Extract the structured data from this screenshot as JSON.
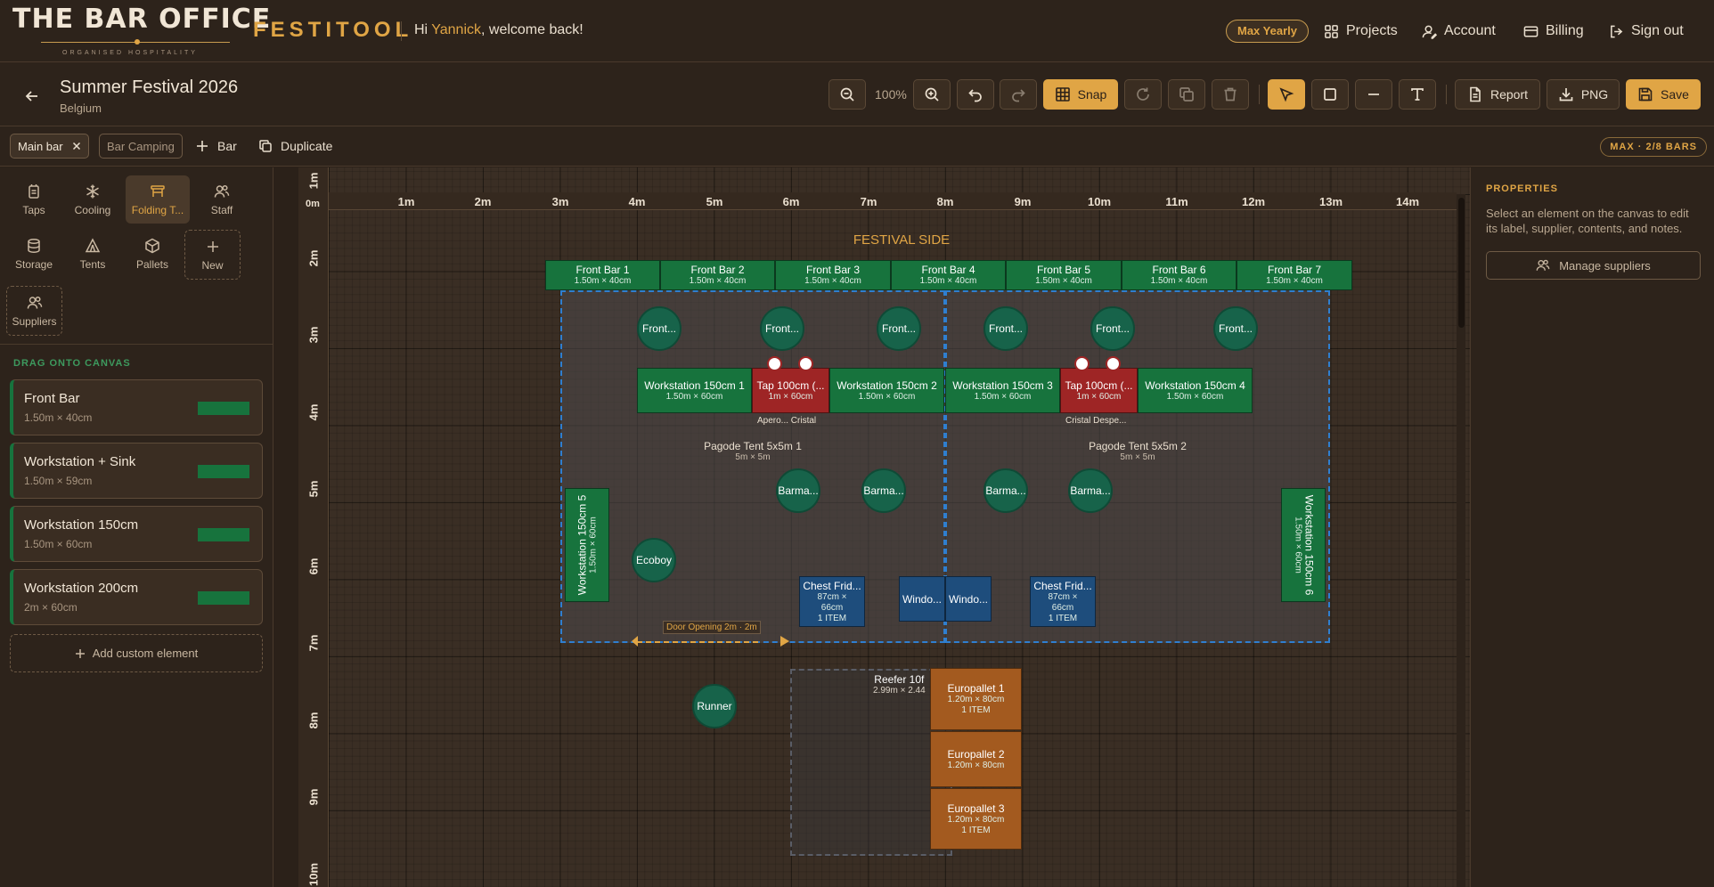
{
  "app": {
    "logo_line1": "THE BAR OFFICE",
    "logo_line2": "ORGANISED HOSPITALITY",
    "product": "FESTITOOL",
    "greeting_prefix": "Hi ",
    "user_name": "Yannick",
    "greeting_suffix": ", welcome back!",
    "plan_badge": "Max Yearly",
    "nav": {
      "projects": "Projects",
      "account": "Account",
      "billing": "Billing",
      "sign_out": "Sign out"
    },
    "accent_color": "#e0a545"
  },
  "project": {
    "title": "Summer Festival 2026",
    "country": "Belgium"
  },
  "toolbar": {
    "zoom": "100%",
    "snap_label": "Snap",
    "report_label": "Report",
    "png_label": "PNG",
    "save_label": "Save",
    "active_tool": "select",
    "snap_enabled": true
  },
  "bars": {
    "tabs": [
      {
        "label": "Main bar",
        "selected": true
      },
      {
        "label": "Bar Camping",
        "selected": false
      }
    ],
    "add_label": "Bar",
    "duplicate_label": "Duplicate",
    "max_badge": "MAX · 2/8 BARS"
  },
  "categories": [
    {
      "label": "Taps",
      "icon": "tap-icon"
    },
    {
      "label": "Cooling",
      "icon": "snowflake-icon"
    },
    {
      "label": "Folding T...",
      "icon": "folding-table-icon",
      "selected": true
    },
    {
      "label": "Staff",
      "icon": "staff-icon"
    },
    {
      "label": "Storage",
      "icon": "storage-icon"
    },
    {
      "label": "Tents",
      "icon": "tent-icon"
    },
    {
      "label": "Pallets",
      "icon": "pallet-icon"
    },
    {
      "label": "New",
      "icon": "plus-icon"
    },
    {
      "label": "Suppliers",
      "icon": "suppliers-icon"
    }
  ],
  "palette": {
    "title": "DRAG ONTO CANVAS",
    "items": [
      {
        "name": "Front Bar",
        "dims": "1.50m × 40cm"
      },
      {
        "name": "Workstation + Sink",
        "dims": "1.50m × 59cm"
      },
      {
        "name": "Workstation 150cm",
        "dims": "1.50m × 60cm"
      },
      {
        "name": "Workstation 200cm",
        "dims": "2m × 60cm"
      }
    ],
    "add_custom": "Add custom element",
    "swatch_color": "#17733d"
  },
  "properties": {
    "title": "PROPERTIES",
    "help": "Select an element on the canvas to edit its label, supplier, contents, and notes.",
    "manage_suppliers": "Manage suppliers"
  },
  "canvas": {
    "ruler_x": [
      "1m",
      "2m",
      "3m",
      "4m",
      "5m",
      "6m",
      "7m",
      "8m",
      "9m",
      "10m",
      "11m",
      "12m",
      "13m",
      "14m"
    ],
    "ruler_y": [
      "1m",
      "2m",
      "3m",
      "4m",
      "5m",
      "6m",
      "7m",
      "8m",
      "9m",
      "10m"
    ],
    "origin": "0m",
    "festival_side": "FESTIVAL SIDE",
    "front_bars": [
      {
        "name": "Front Bar 1",
        "dims": "1.50m × 40cm"
      },
      {
        "name": "Front Bar 2",
        "dims": "1.50m × 40cm"
      },
      {
        "name": "Front Bar 3",
        "dims": "1.50m × 40cm"
      },
      {
        "name": "Front Bar 4",
        "dims": "1.50m × 40cm"
      },
      {
        "name": "Front Bar 5",
        "dims": "1.50m × 40cm"
      },
      {
        "name": "Front Bar 6",
        "dims": "1.50m × 40cm"
      },
      {
        "name": "Front Bar 7",
        "dims": "1.50m × 40cm"
      }
    ],
    "tents": [
      {
        "name": "Pagode Tent 5x5m 1",
        "dims": "5m × 5m"
      },
      {
        "name": "Pagode Tent 5x5m 2",
        "dims": "5m × 5m"
      }
    ],
    "front_staff": [
      "Front...",
      "Front...",
      "Front...",
      "Front...",
      "Front...",
      "Front..."
    ],
    "workstations": [
      {
        "name": "Workstation 150cm 1",
        "dims": "1.50m × 60cm"
      },
      {
        "name": "Workstation 150cm 2",
        "dims": "1.50m × 60cm"
      },
      {
        "name": "Workstation 150cm 3",
        "dims": "1.50m × 60cm"
      },
      {
        "name": "Workstation 150cm 4",
        "dims": "1.50m × 60cm"
      },
      {
        "name": "Workstation 150cm 5",
        "dims": "1.50m × 60cm"
      },
      {
        "name": "Workstation 150cm 6",
        "dims": "1.50m × 60cm"
      }
    ],
    "taps": [
      {
        "name": "Tap 100cm (...",
        "dims": "1m × 60cm",
        "labels": "Apero...   Cristal"
      },
      {
        "name": "Tap 100cm (...",
        "dims": "1m × 60cm",
        "labels": "Cristal   Despe..."
      }
    ],
    "barmen": [
      "Barma...",
      "Barma...",
      "Barma...",
      "Barma..."
    ],
    "ecoboy": "Ecoboy",
    "runner": "Runner",
    "chest_fridges": [
      {
        "name": "Chest Frid...",
        "dims": "87cm ×",
        "dims2": "66cm",
        "items": "1 ITEM"
      },
      {
        "name": "Chest Frid...",
        "dims": "87cm ×",
        "dims2": "66cm",
        "items": "1 ITEM"
      }
    ],
    "windows": [
      "Windo...",
      "Windo..."
    ],
    "door": "Door Opening 2m · 2m",
    "reefer": {
      "name": "Reefer 10f",
      "dims": "2.99m × 2.44"
    },
    "pallets": [
      {
        "name": "Europallet 1",
        "dims": "1.20m × 80cm",
        "items": "1 ITEM"
      },
      {
        "name": "Europallet 2",
        "dims": "1.20m × 80cm",
        "items": ""
      },
      {
        "name": "Europallet 3",
        "dims": "1.20m × 80cm",
        "items": "1 ITEM"
      }
    ]
  }
}
